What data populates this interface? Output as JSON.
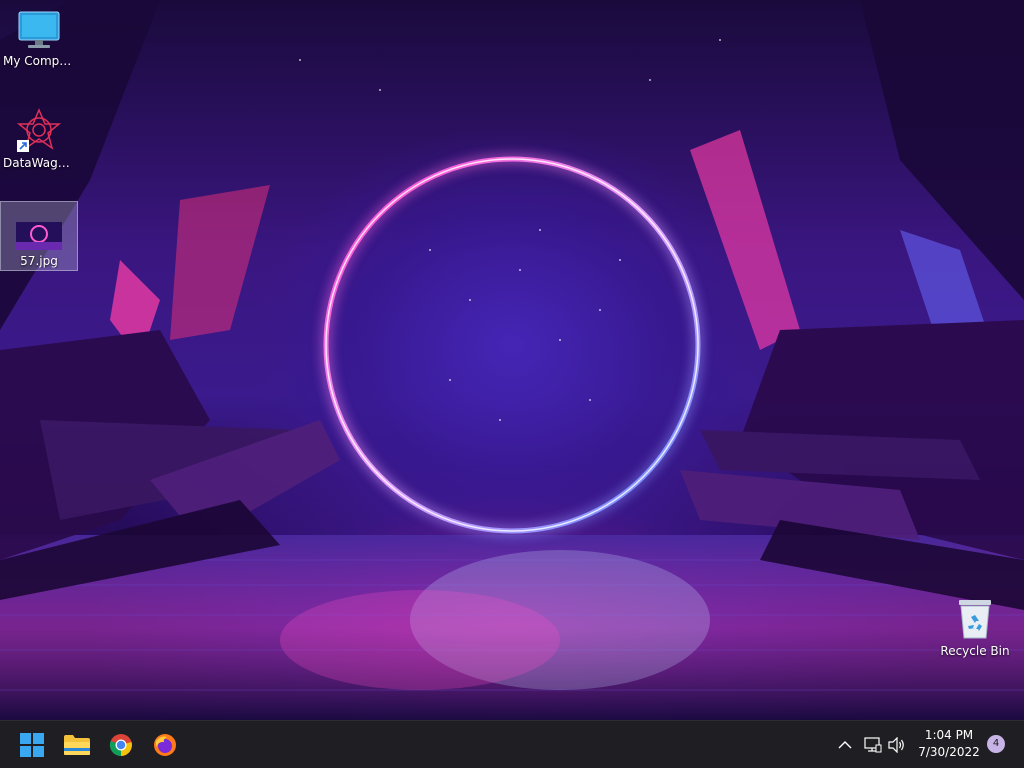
{
  "desktop": {
    "icons": [
      {
        "label": "My Computer",
        "icon": "monitor-icon"
      },
      {
        "label": "DataWagon...",
        "icon": "datawagon-shortcut-icon"
      },
      {
        "label": "57.jpg",
        "icon": "image-file-icon"
      },
      {
        "label": "Recycle Bin",
        "icon": "recycle-bin-icon"
      }
    ]
  },
  "taskbar": {
    "apps": [
      {
        "name": "Start",
        "icon": "windows-start-icon"
      },
      {
        "name": "File Explorer",
        "icon": "folder-icon"
      },
      {
        "name": "Google Chrome",
        "icon": "chrome-icon"
      },
      {
        "name": "Firefox",
        "icon": "firefox-icon"
      }
    ],
    "tray": {
      "icons": [
        "chevron-up-icon",
        "network-icon",
        "volume-icon"
      ],
      "time": "1:04 PM",
      "date": "7/30/2022",
      "notification_count": "4"
    }
  },
  "colors": {
    "taskbar_bg": "#1f1f23",
    "ring_pink": "#ff3fc0",
    "ring_blue": "#6aa8ff"
  }
}
